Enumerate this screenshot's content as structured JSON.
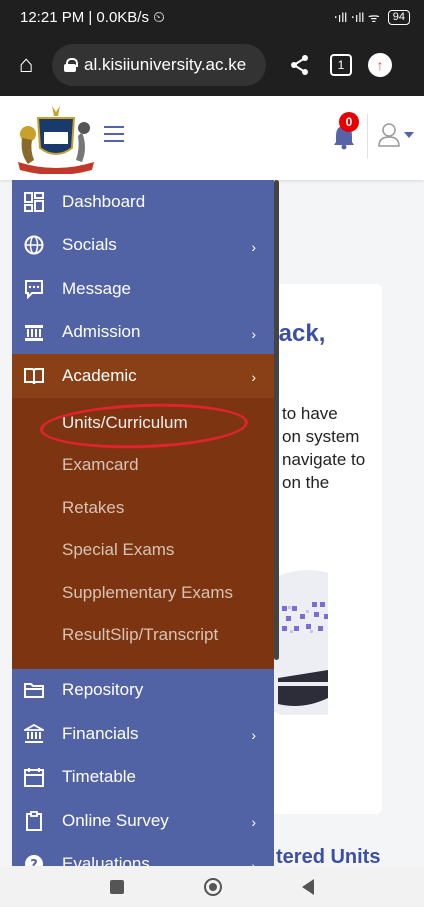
{
  "status_bar": {
    "time_info": "12:21 PM | 0.0KB/s ⏲",
    "signal": "‧ıll ‧ıll ᯤ",
    "battery": "94"
  },
  "browser": {
    "url": "al.kisiiuniversity.ac.ke",
    "tab_count": "1"
  },
  "header": {
    "notification_count": "0"
  },
  "sidebar": {
    "items": [
      {
        "label": "Dashboard",
        "icon": "dashboard-icon"
      },
      {
        "label": "Socials",
        "icon": "globe-icon"
      },
      {
        "label": "Message",
        "icon": "message-icon"
      },
      {
        "label": "Admission",
        "icon": "building-icon"
      },
      {
        "label": "Academic",
        "icon": "book-icon"
      }
    ],
    "academic_sub": [
      "Units/Curriculum",
      "Examcard",
      "Retakes",
      "Special Exams",
      "Supplementary Exams",
      "ResultSlip/Transcript"
    ],
    "items_after": [
      {
        "label": "Repository",
        "icon": "folder-icon"
      },
      {
        "label": "Financials",
        "icon": "bank-icon"
      },
      {
        "label": "Timetable",
        "icon": "calendar-icon"
      },
      {
        "label": "Online Survey",
        "icon": "clipboard-icon"
      },
      {
        "label": "Evaluations",
        "icon": "help-icon"
      }
    ]
  },
  "content": {
    "welcome_partial": "back,",
    "text_lines": [
      "to have",
      "on system",
      "navigate to",
      "on the"
    ],
    "section_heading_partial": "tered Units"
  },
  "colors": {
    "sidebar": "#5263a5",
    "active": "#8a4016",
    "submenu": "#7c3510",
    "accent": "#3c4fa3",
    "annotation": "#e0232e"
  }
}
